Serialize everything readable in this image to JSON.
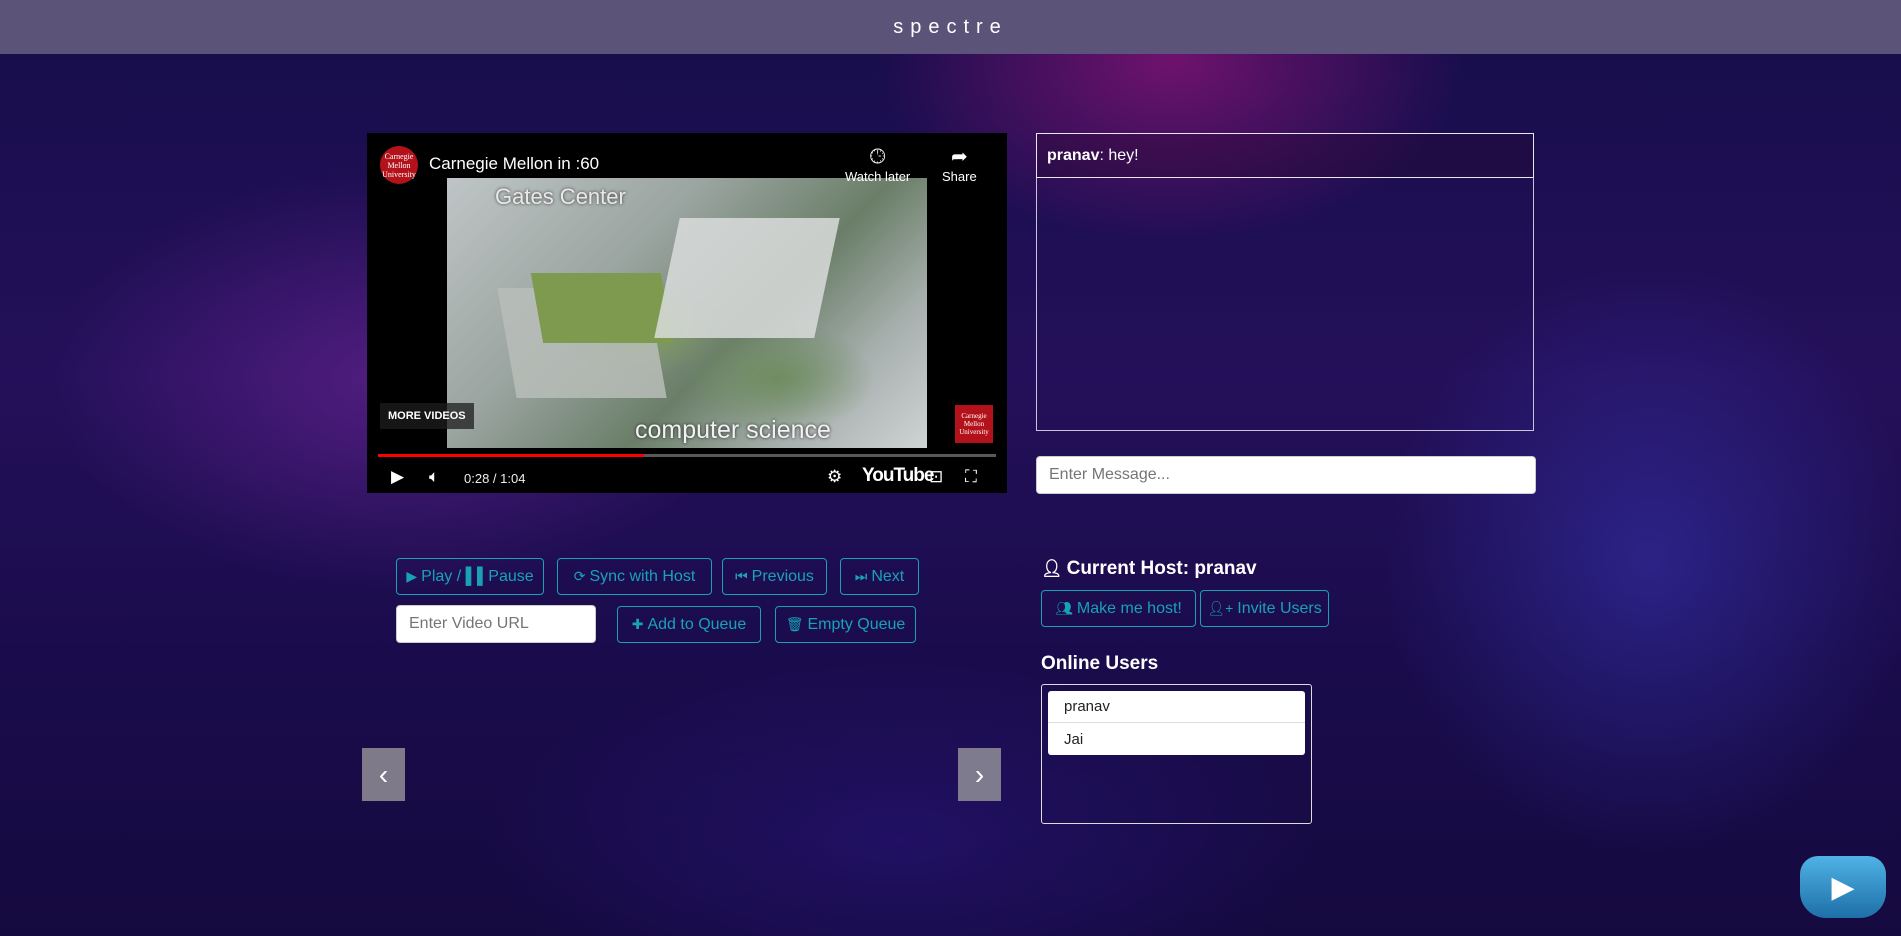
{
  "app": {
    "title": "spectre"
  },
  "video": {
    "title": "Carnegie Mellon in :60",
    "channel_logo_text": "Carnegie Mellon University",
    "watch_later_label": "Watch later",
    "share_label": "Share",
    "more_videos_label": "MORE VIDEOS",
    "frame_caption_top": "Gates Center",
    "frame_caption_bottom": "computer science",
    "time_display": "0:28 / 1:04",
    "progress": 0.43,
    "youtube_label": "YouTube"
  },
  "controls": {
    "play_pause_label": "Play / ▌▌Pause",
    "sync_label": "Sync with Host",
    "previous_label": "Previous",
    "next_label": "Next",
    "video_url_placeholder": "Enter Video URL",
    "add_queue_label": "Add to Queue",
    "empty_queue_label": "Empty Queue"
  },
  "chat": {
    "messages": [
      {
        "user": "pranav",
        "text": ": hey!"
      }
    ],
    "input_placeholder": "Enter Message..."
  },
  "host": {
    "current_host_label": "Current Host: pranav",
    "make_host_label": "Make me host!",
    "invite_label": "Invite Users"
  },
  "online_users": {
    "title": "Online Users",
    "users": [
      "pranav",
      "Jai"
    ]
  },
  "colors": {
    "accent": "#17a2b8",
    "topbar": "#5c5478",
    "youtube_red": "#ff0000"
  },
  "icons": [
    "play-icon",
    "pause-icon",
    "sync-icon",
    "previous-icon",
    "next-icon",
    "plus-icon",
    "trash-icon",
    "user-icon",
    "users-icon",
    "user-plus-icon",
    "chevron-left-icon",
    "chevron-right-icon"
  ]
}
